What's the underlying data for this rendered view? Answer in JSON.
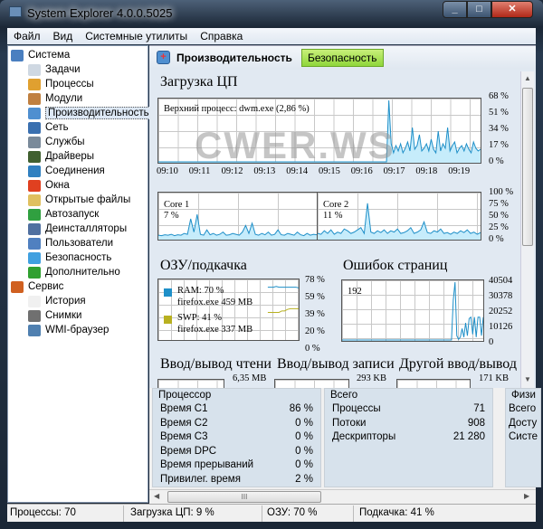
{
  "window": {
    "title": "System Explorer 4.0.0.5025"
  },
  "menu": [
    "Файл",
    "Вид",
    "Системные утилиты",
    "Справка"
  ],
  "sidebar": {
    "items": [
      {
        "label": "Система",
        "level": 0,
        "color": "#4a7fc0"
      },
      {
        "label": "Задачи",
        "level": 1,
        "color": "#cfd8e2"
      },
      {
        "label": "Процессы",
        "level": 1,
        "color": "#e0a030"
      },
      {
        "label": "Модули",
        "level": 1,
        "color": "#c08040"
      },
      {
        "label": "Производительность",
        "level": 1,
        "color": "#4f8fd0",
        "selected": true
      },
      {
        "label": "Сеть",
        "level": 1,
        "color": "#3a70b0"
      },
      {
        "label": "Службы",
        "level": 1,
        "color": "#7a8a9a"
      },
      {
        "label": "Драйверы",
        "level": 1,
        "color": "#406030"
      },
      {
        "label": "Соединения",
        "level": 1,
        "color": "#3080c0"
      },
      {
        "label": "Окна",
        "level": 1,
        "color": "#e04020"
      },
      {
        "label": "Открытые файлы",
        "level": 1,
        "color": "#e0c060"
      },
      {
        "label": "Автозапуск",
        "level": 1,
        "color": "#30a040"
      },
      {
        "label": "Деинсталляторы",
        "level": 1,
        "color": "#5070a0"
      },
      {
        "label": "Пользователи",
        "level": 1,
        "color": "#5080c0"
      },
      {
        "label": "Безопасность",
        "level": 1,
        "color": "#40a0e0"
      },
      {
        "label": "Дополнительно",
        "level": 1,
        "color": "#30a030"
      },
      {
        "label": "Сервис",
        "level": 0,
        "color": "#d06020"
      },
      {
        "label": "История",
        "level": 1,
        "color": "#f0f0f0"
      },
      {
        "label": "Снимки",
        "level": 1,
        "color": "#707070"
      },
      {
        "label": "WMI-браузер",
        "level": 1,
        "color": "#5080b0"
      }
    ]
  },
  "tabs": {
    "performance": "Производительность",
    "security": "Безопасность"
  },
  "cpu": {
    "title": "Загрузка ЦП",
    "top_process": "Верхний процесс: dwm.exe (2,86 %)",
    "y_ticks": [
      "68 %",
      "51 %",
      "34 %",
      "17 %",
      "0 %"
    ],
    "x_ticks": [
      "09:10",
      "09:11",
      "09:12",
      "09:13",
      "09:14",
      "09:15",
      "09:16",
      "09:17",
      "09:18",
      "09:19"
    ],
    "series": [
      0,
      0,
      0,
      0,
      0,
      0,
      0,
      0,
      0,
      0,
      0,
      0,
      0,
      0,
      0,
      0,
      0,
      0,
      0,
      0,
      0,
      0,
      0,
      0,
      0,
      0,
      0,
      0,
      0,
      0,
      0,
      0,
      0,
      0,
      0,
      0,
      0,
      0,
      0,
      0,
      0,
      0,
      0,
      0,
      0,
      0,
      0,
      0,
      0,
      0,
      0,
      0,
      0,
      0,
      0,
      0,
      0,
      0,
      0,
      0,
      0,
      0,
      0,
      0,
      0,
      0,
      0,
      0,
      0,
      0,
      0,
      0,
      0,
      0,
      0,
      0,
      0,
      0,
      0,
      0,
      0,
      0,
      0,
      0,
      0,
      0,
      0,
      0,
      0,
      0,
      0,
      0,
      0,
      0,
      0,
      0,
      0,
      0,
      68,
      20,
      10,
      18,
      12,
      20,
      10,
      15,
      22,
      12,
      38,
      14,
      18,
      30,
      12,
      15,
      20,
      12,
      25,
      14,
      10,
      34,
      12,
      20,
      15,
      38,
      12,
      18,
      22,
      10,
      15,
      18,
      12,
      20,
      14,
      10,
      22,
      15,
      12,
      14
    ]
  },
  "watermark": "CWER.WS",
  "cores": {
    "y_ticks": [
      "100 %",
      "75 %",
      "50 %",
      "25 %",
      "0 %"
    ],
    "items": [
      {
        "name": "Core 1",
        "value": "7 %",
        "series": [
          8,
          7,
          9,
          8,
          10,
          7,
          9,
          8,
          12,
          10,
          45,
          15,
          55,
          10,
          8,
          20,
          9,
          12,
          8,
          10,
          15,
          8,
          9,
          12,
          10,
          8,
          15,
          30,
          12,
          35,
          10,
          8,
          12,
          9,
          15,
          8,
          10,
          20,
          9,
          8,
          12,
          10,
          8,
          15,
          9,
          7,
          12,
          8,
          10,
          9
        ]
      },
      {
        "name": "Core 2",
        "value": "11 %",
        "series": [
          12,
          10,
          18,
          12,
          20,
          10,
          15,
          12,
          22,
          18,
          12,
          15,
          20,
          25,
          12,
          80,
          15,
          12,
          18,
          14,
          20,
          12,
          18,
          15,
          22,
          12,
          14,
          18,
          25,
          12,
          15,
          20,
          38,
          14,
          12,
          18,
          15,
          22,
          12,
          14,
          10,
          15,
          12,
          18,
          14,
          20,
          12,
          15,
          10,
          14
        ]
      }
    ]
  },
  "memory": {
    "title": "ОЗУ/подкачка",
    "y_ticks": [
      "78 %",
      "59 %",
      "39 %",
      "20 %",
      "0 %"
    ],
    "ram": {
      "label": "RAM: 70 %",
      "process": "firefox.exe 459 MB",
      "color": "#1e8fc8",
      "series": [
        70,
        70,
        70,
        71,
        70,
        70,
        70,
        70,
        70,
        70,
        70,
        69
      ]
    },
    "swp": {
      "label": "SWP: 41 %",
      "process": "firefox.exe 337 MB",
      "color": "#b8b020",
      "series": [
        36,
        36,
        36,
        36,
        36,
        38,
        38,
        40,
        41,
        41,
        41,
        41
      ]
    }
  },
  "page_faults": {
    "title": "Ошибок страниц",
    "current": "192",
    "y_ticks": [
      "40504",
      "30378",
      "20252",
      "10126",
      "0"
    ],
    "series": [
      0,
      0,
      0,
      0,
      0,
      0,
      0,
      0,
      0,
      0,
      0,
      0,
      0,
      0,
      0,
      0,
      0,
      0,
      0,
      0,
      0,
      0,
      0,
      0,
      0,
      0,
      0,
      0,
      0,
      0,
      0,
      0,
      0,
      0,
      0,
      0,
      0,
      0,
      0,
      0,
      0,
      0,
      0,
      0,
      0,
      0,
      0,
      0,
      0,
      0,
      0,
      0,
      0,
      0,
      0,
      0,
      0,
      0,
      0,
      0,
      0,
      0,
      0,
      0,
      0,
      0,
      0,
      0,
      0,
      0,
      0,
      0,
      0,
      0,
      0,
      0,
      0,
      0,
      0,
      0,
      0,
      0,
      0,
      0,
      0,
      0,
      0,
      0,
      0,
      0,
      0,
      0,
      0,
      0,
      0,
      0,
      0,
      0,
      0,
      0,
      0,
      0,
      0,
      0,
      0,
      0,
      0,
      0,
      0,
      0,
      0,
      0,
      0,
      0,
      0,
      0,
      0,
      0,
      0,
      0,
      0,
      0,
      0,
      0,
      0,
      0,
      0,
      0,
      0,
      0,
      0,
      0,
      0,
      0,
      0,
      0,
      0,
      0,
      0,
      0,
      0,
      0,
      0,
      0,
      0,
      0,
      0,
      0,
      0,
      0,
      0,
      0,
      0,
      0,
      0,
      0,
      0,
      0,
      0,
      0,
      0,
      0,
      0,
      0,
      0,
      0,
      0,
      0,
      0,
      0,
      0,
      0,
      0,
      0,
      0,
      0,
      0,
      0,
      0,
      0,
      0,
      0,
      0,
      0,
      0,
      0,
      0,
      0,
      0,
      0,
      0,
      0,
      0,
      0,
      0,
      0,
      0,
      0,
      0,
      0,
      0,
      0,
      0,
      0,
      0,
      0,
      0,
      0,
      0,
      0,
      0,
      0,
      0,
      0,
      0,
      0,
      0,
      0,
      0,
      0,
      0,
      0,
      0,
      0,
      0,
      0,
      0,
      0,
      0,
      0,
      0,
      0,
      0,
      0,
      0,
      0,
      0,
      0,
      0,
      0,
      0,
      0,
      0,
      0,
      0,
      0,
      0,
      0,
      0,
      0,
      0,
      0,
      0,
      0,
      0,
      0,
      0,
      0,
      0,
      0,
      0,
      0,
      0,
      0,
      0,
      0,
      0,
      0,
      0,
      0,
      0,
      0,
      0,
      0,
      0,
      0,
      0,
      0,
      0,
      0,
      0,
      0,
      0,
      0,
      0,
      0,
      0,
      0,
      0,
      0,
      0,
      0,
      0,
      0,
      0,
      0,
      0,
      0,
      0,
      0,
      0,
      0,
      0,
      0
    ]
  },
  "io": [
    {
      "title": "Ввод/вывод чтени",
      "max": "6,35 MB"
    },
    {
      "title": "Ввод/вывод записи",
      "max": "293 KB"
    },
    {
      "title": "Другой ввод/вывод",
      "max": "171 KB"
    }
  ],
  "panels": [
    {
      "title": "Процессор",
      "rows": [
        [
          "Время C1",
          "86 %"
        ],
        [
          "Время C2",
          "0 %"
        ],
        [
          "Время C3",
          "0 %"
        ],
        [
          "Время DPC",
          "0 %"
        ],
        [
          "Время прерываний",
          "0 %"
        ],
        [
          "Привилег. время",
          "2 %"
        ]
      ]
    },
    {
      "title": "Всего",
      "rows": [
        [
          "Процессы",
          "71"
        ],
        [
          "Потоки",
          "908"
        ],
        [
          "Дескрипторы",
          "21 280"
        ]
      ]
    },
    {
      "title": "Физи",
      "rows": [
        [
          "Всего",
          ""
        ],
        [
          "Досту",
          ""
        ],
        [
          "Систе",
          ""
        ]
      ]
    }
  ],
  "status": {
    "processes": "Процессы: 70",
    "cpu": "Загрузка ЦП: 9 %",
    "ram": "ОЗУ: 70 %",
    "swap": "Подкачка: 41 %"
  },
  "colors": {
    "line": "#1e8fc8",
    "fill": "#c6ecfb",
    "security_tab": "#a8e050"
  }
}
